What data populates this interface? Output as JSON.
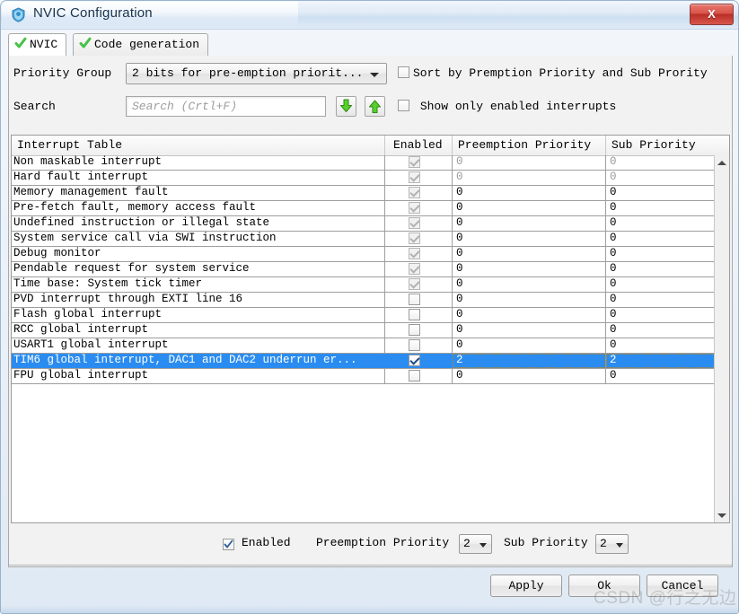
{
  "window": {
    "title": "NVIC Configuration",
    "app_icon": "shield-icon",
    "close_label": "X"
  },
  "tabs": [
    {
      "label": "NVIC",
      "icon": "green-check-icon",
      "active": true
    },
    {
      "label": "Code generation",
      "icon": "green-check-icon",
      "active": false
    }
  ],
  "toolbar": {
    "priority_group_label": "Priority Group",
    "priority_group_value": "2 bits for pre-emption priorit...",
    "search_label": "Search",
    "search_value": "",
    "search_placeholder": "Search (Crtl+F)",
    "search_down_icon": "down-arrow-icon",
    "search_up_icon": "up-arrow-icon",
    "sort_checkbox_label": "Sort by Premption Priority and Sub Prority",
    "sort_checkbox_checked": false,
    "show_only_enabled_label": "Show only enabled interrupts",
    "show_only_enabled_checked": false
  },
  "table": {
    "columns": [
      "Interrupt Table",
      "Enabled",
      "Preemption Priority",
      "Sub Priority"
    ],
    "rows": [
      {
        "name": "Non maskable interrupt",
        "enabled": "checked-disabled",
        "preemption": "0",
        "sub": "0",
        "dim": true,
        "selected": false
      },
      {
        "name": "Hard fault interrupt",
        "enabled": "checked-disabled",
        "preemption": "0",
        "sub": "0",
        "dim": true,
        "selected": false
      },
      {
        "name": "Memory management fault",
        "enabled": "checked-disabled",
        "preemption": "0",
        "sub": "0",
        "dim": false,
        "selected": false
      },
      {
        "name": "Pre-fetch fault, memory access fault",
        "enabled": "checked-disabled",
        "preemption": "0",
        "sub": "0",
        "dim": false,
        "selected": false
      },
      {
        "name": "Undefined instruction or illegal state",
        "enabled": "checked-disabled",
        "preemption": "0",
        "sub": "0",
        "dim": false,
        "selected": false
      },
      {
        "name": "System service call via SWI instruction",
        "enabled": "checked-disabled",
        "preemption": "0",
        "sub": "0",
        "dim": false,
        "selected": false
      },
      {
        "name": "Debug monitor",
        "enabled": "checked-disabled",
        "preemption": "0",
        "sub": "0",
        "dim": false,
        "selected": false
      },
      {
        "name": "Pendable request for system service",
        "enabled": "checked-disabled",
        "preemption": "0",
        "sub": "0",
        "dim": false,
        "selected": false
      },
      {
        "name": "Time base: System tick timer",
        "enabled": "checked-disabled",
        "preemption": "0",
        "sub": "0",
        "dim": false,
        "selected": false
      },
      {
        "name": "PVD interrupt through EXTI line 16",
        "enabled": "unchecked",
        "preemption": "0",
        "sub": "0",
        "dim": false,
        "selected": false
      },
      {
        "name": "Flash global interrupt",
        "enabled": "unchecked",
        "preemption": "0",
        "sub": "0",
        "dim": false,
        "selected": false
      },
      {
        "name": "RCC global interrupt",
        "enabled": "unchecked",
        "preemption": "0",
        "sub": "0",
        "dim": false,
        "selected": false
      },
      {
        "name": "USART1 global interrupt",
        "enabled": "unchecked",
        "preemption": "0",
        "sub": "0",
        "dim": false,
        "selected": false
      },
      {
        "name": "TIM6 global interrupt, DAC1 and DAC2 underrun er...",
        "enabled": "checked",
        "preemption": "2",
        "sub": "2",
        "dim": false,
        "selected": true
      },
      {
        "name": "FPU global interrupt",
        "enabled": "unchecked",
        "preemption": "0",
        "sub": "0",
        "dim": false,
        "selected": false
      }
    ]
  },
  "scrollbar": {
    "up_icon": "scroll-up-icon",
    "down_icon": "scroll-down-icon"
  },
  "editbar": {
    "enabled_label": "Enabled",
    "enabled_checked": true,
    "preemption_label": "Preemption Priority",
    "preemption_value": "2",
    "sub_label": "Sub Priority",
    "sub_value": "2"
  },
  "buttons": {
    "apply": "Apply",
    "ok": "Ok",
    "cancel": "Cancel"
  },
  "watermark": "CSDN @行之无边",
  "colors": {
    "selection": "#2a8cf0",
    "title_text": "#17324e",
    "close_button": "#b92e26",
    "tab_check": "#3fbf3f"
  }
}
